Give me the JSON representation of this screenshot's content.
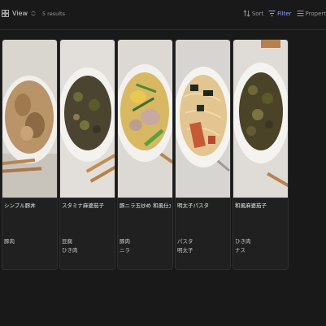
{
  "toolbar": {
    "view_label": "View",
    "results": "5 results",
    "sort_label": "Sort",
    "filter_label": "Filter",
    "properties_label": "Propert"
  },
  "cards": [
    {
      "title": "シンプル豚丼",
      "tags": [
        "豚肉"
      ]
    },
    {
      "title": "スタミナ麻婆茄子",
      "tags": [
        "豆腐",
        "ひき肉"
      ]
    },
    {
      "title": "豚ニラ玉炒め 和風仕立て",
      "tags": [
        "豚肉",
        "ニラ"
      ]
    },
    {
      "title": "明太子パスタ",
      "tags": [
        "パスタ",
        "明太子"
      ]
    },
    {
      "title": "和風麻婆茄子",
      "tags": [
        "ひき肉",
        "ナス"
      ]
    }
  ],
  "icons": {
    "view": "grid-icon",
    "sort": "sort-arrows-icon",
    "filter": "filter-icon",
    "properties": "list-icon"
  },
  "colors": {
    "background": "#191919",
    "card": "#202020",
    "accent": "#8fa3ff"
  }
}
